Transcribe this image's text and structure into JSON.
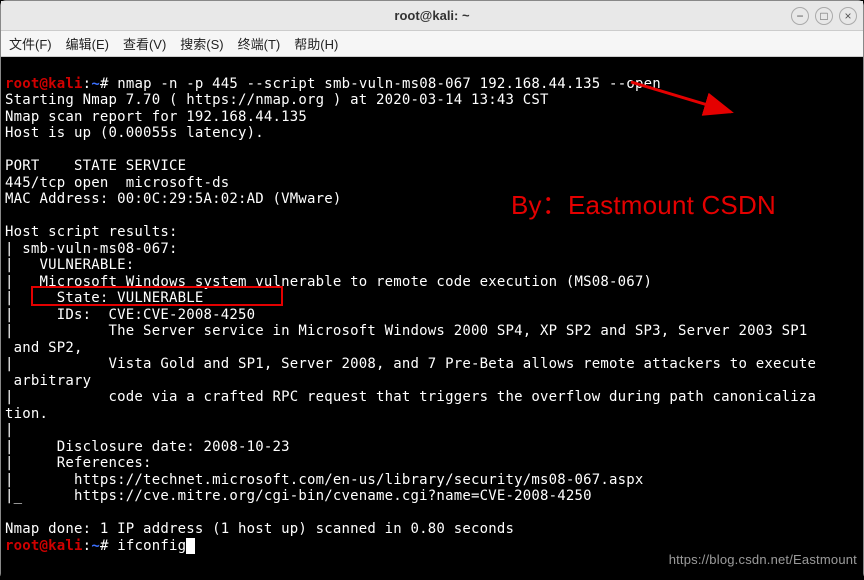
{
  "window": {
    "title": "root@kali: ~",
    "controls": {
      "min": "−",
      "max": "□",
      "close": "×"
    }
  },
  "menubar": {
    "file": "文件(F)",
    "edit": "编辑(E)",
    "view": "查看(V)",
    "search": "搜索(S)",
    "terminal": "终端(T)",
    "help": "帮助(H)"
  },
  "prompt": {
    "user": "root",
    "at": "@",
    "host": "kali",
    "sep": ":",
    "path": "~",
    "hash": "#"
  },
  "cmd1": " nmap -n -p 445 --script smb-vuln-ms08-067 192.168.44.135 --open",
  "cmd2": " ifconfig",
  "out": {
    "l1": "Starting Nmap 7.70 ( https://nmap.org ) at 2020-03-14 13:43 CST",
    "l2": "Nmap scan report for 192.168.44.135",
    "l3": "Host is up (0.00055s latency).",
    "l4": "",
    "l5": "PORT    STATE SERVICE",
    "l6": "445/tcp open  microsoft-ds",
    "l7": "MAC Address: 00:0C:29:5A:02:AD (VMware)",
    "l8": "",
    "l9": "Host script results:",
    "l10": "| smb-vuln-ms08-067:",
    "l11": "|   VULNERABLE:",
    "l12": "|   Microsoft Windows system vulnerable to remote code execution (MS08-067)",
    "l13": "|     State: VULNERABLE",
    "l14": "|     IDs:  CVE:CVE-2008-4250",
    "l15": "|           The Server service in Microsoft Windows 2000 SP4, XP SP2 and SP3, Server 2003 SP1",
    "l15b": " and SP2,",
    "l16": "|           Vista Gold and SP1, Server 2008, and 7 Pre-Beta allows remote attackers to execute",
    "l16b": " arbitrary",
    "l17": "|           code via a crafted RPC request that triggers the overflow during path canonicaliza",
    "l17b": "tion.",
    "l18": "|",
    "l19": "|     Disclosure date: 2008-10-23",
    "l20": "|     References:",
    "l21": "|       https://technet.microsoft.com/en-us/library/security/ms08-067.aspx",
    "l22": "|_      https://cve.mitre.org/cgi-bin/cvename.cgi?name=CVE-2008-4250",
    "l23": "",
    "l24": "Nmap done: 1 IP address (1 host up) scanned in 0.80 seconds"
  },
  "annotations": {
    "by": "By：Eastmount CSDN",
    "url": "https://blog.csdn.net/Eastmount"
  }
}
